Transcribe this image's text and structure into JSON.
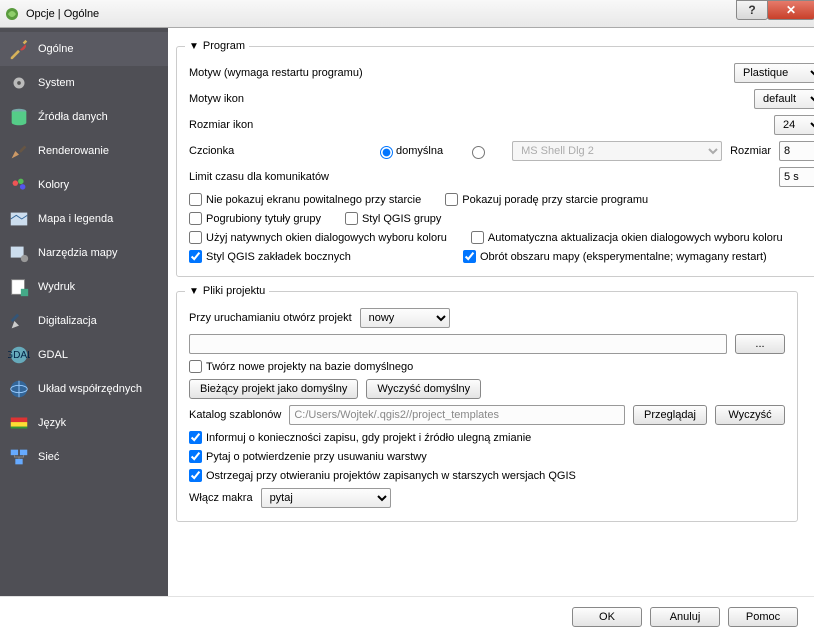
{
  "title": "Opcje | Ogólne",
  "sidebar": [
    {
      "id": "general",
      "label": "Ogólne"
    },
    {
      "id": "system",
      "label": "System"
    },
    {
      "id": "datasources",
      "label": "Źródła danych"
    },
    {
      "id": "rendering",
      "label": "Renderowanie"
    },
    {
      "id": "colors",
      "label": "Kolory"
    },
    {
      "id": "maplegend",
      "label": "Mapa i legenda"
    },
    {
      "id": "maptools",
      "label": "Narzędzia mapy"
    },
    {
      "id": "print",
      "label": "Wydruk"
    },
    {
      "id": "digitizing",
      "label": "Digitalizacja"
    },
    {
      "id": "gdal",
      "label": "GDAL"
    },
    {
      "id": "crs",
      "label": "Układ współrzędnych"
    },
    {
      "id": "language",
      "label": "Język"
    },
    {
      "id": "network",
      "label": "Sieć"
    }
  ],
  "group_program": "Program",
  "theme_label": "Motyw (wymaga restartu programu)",
  "theme_value": "Plastique",
  "icon_theme_label": "Motyw ikon",
  "icon_theme_value": "default",
  "icon_size_label": "Rozmiar ikon",
  "icon_size_value": "24",
  "font_label": "Czcionka",
  "font_default_label": "domyślna",
  "font_name": "MS Shell Dlg 2",
  "font_size_label": "Rozmiar",
  "font_size_value": "8",
  "msg_timeout_label": "Limit czasu dla komunikatów",
  "msg_timeout_value": "5 s",
  "chk_hide_splash": "Nie pokazuj ekranu powitalnego przy starcie",
  "chk_show_tips": "Pokazuj poradę przy starcie programu",
  "chk_bold_group": "Pogrubiony tytuły grupy",
  "chk_qgis_group_style": "Styl QGIS grupy",
  "chk_native_color": "Użyj natywnych okien dialogowych wyboru koloru",
  "chk_live_color": "Automatyczna aktualizacja okien dialogowych wyboru koloru",
  "chk_side_tabs": "Styl QGIS zakładek bocznych",
  "chk_canvas_rotation": "Obrót obszaru mapy (eksperymentalne; wymagany restart)",
  "group_project": "Pliki projektu",
  "open_project_label": "Przy uruchamianiu otwórz projekt",
  "open_project_value": "nowy",
  "browse_btn": "...",
  "chk_new_from_default": "Twórz nowe projekty na bazie domyślnego",
  "btn_set_default": "Bieżący projekt jako domyślny",
  "btn_clear_default": "Wyczyść domyślny",
  "template_dir_label": "Katalog szablonów",
  "template_dir_value": "C:/Users/Wojtek/.qgis2//project_templates",
  "btn_browse": "Przeglądaj",
  "btn_clear": "Wyczyść",
  "chk_prompt_save": "Informuj o konieczności zapisu, gdy projekt i źródło ulegną zmianie",
  "chk_confirm_remove_layer": "Pytaj o potwierdzenie przy usuwaniu warstwy",
  "chk_warn_old": "Ostrzegaj przy otwieraniu projektów zapisanych w starszych wersjach QGIS",
  "macros_label": "Włącz makra",
  "macros_value": "pytaj",
  "btn_ok": "OK",
  "btn_cancel": "Anuluj",
  "btn_help": "Pomoc"
}
